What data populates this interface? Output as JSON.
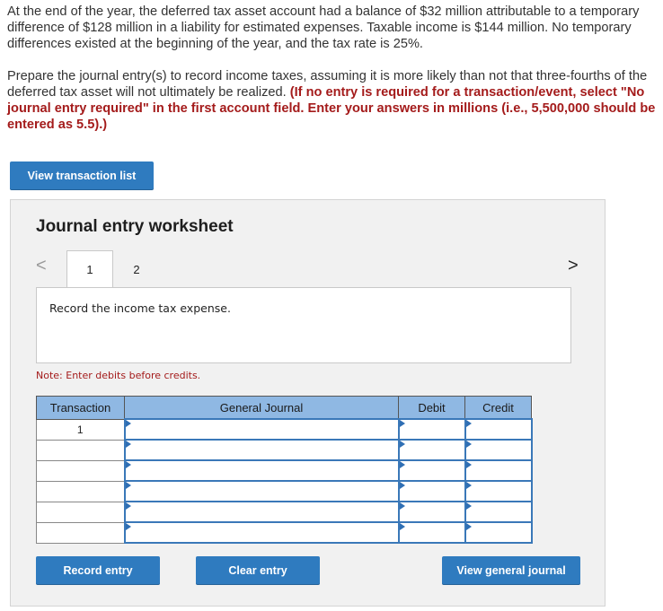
{
  "problem": {
    "paragraph1": "At the end of the year, the deferred tax asset account had a balance of $32 million attributable to a temporary difference of $128 million in a liability for estimated expenses. Taxable income is $144 million. No temporary differences existed at the beginning of the year, and the tax rate is 25%.",
    "paragraph2": "Prepare the journal entry(s) to record income taxes, assuming it is more likely than not that three-fourths of the deferred tax asset will not ultimately be realized.",
    "instruction": "(If no entry is required for a transaction/event, select \"No journal entry required\" in the first account field. Enter your answers in millions (i.e., 5,500,000 should be entered as 5.5).)"
  },
  "buttons": {
    "view_transaction_list": "View transaction list",
    "record_entry": "Record entry",
    "clear_entry": "Clear entry",
    "view_general_journal": "View general journal"
  },
  "worksheet": {
    "title": "Journal entry worksheet",
    "tabs": [
      "1",
      "2"
    ],
    "active_tab": "1",
    "nav_prev": "<",
    "nav_next": ">",
    "prompt": "Record the income tax expense.",
    "note": "Note: Enter debits before credits."
  },
  "table": {
    "headers": [
      "Transaction",
      "General Journal",
      "Debit",
      "Credit"
    ],
    "rows": [
      {
        "transaction": "1",
        "account": "",
        "debit": "",
        "credit": ""
      },
      {
        "transaction": "",
        "account": "",
        "debit": "",
        "credit": ""
      },
      {
        "transaction": "",
        "account": "",
        "debit": "",
        "credit": ""
      },
      {
        "transaction": "",
        "account": "",
        "debit": "",
        "credit": ""
      },
      {
        "transaction": "",
        "account": "",
        "debit": "",
        "credit": ""
      },
      {
        "transaction": "",
        "account": "",
        "debit": "",
        "credit": ""
      }
    ]
  },
  "colors": {
    "accent": "#2f7bbf",
    "header_bg": "#8fb8e3",
    "emphasis": "#a41b1b"
  }
}
